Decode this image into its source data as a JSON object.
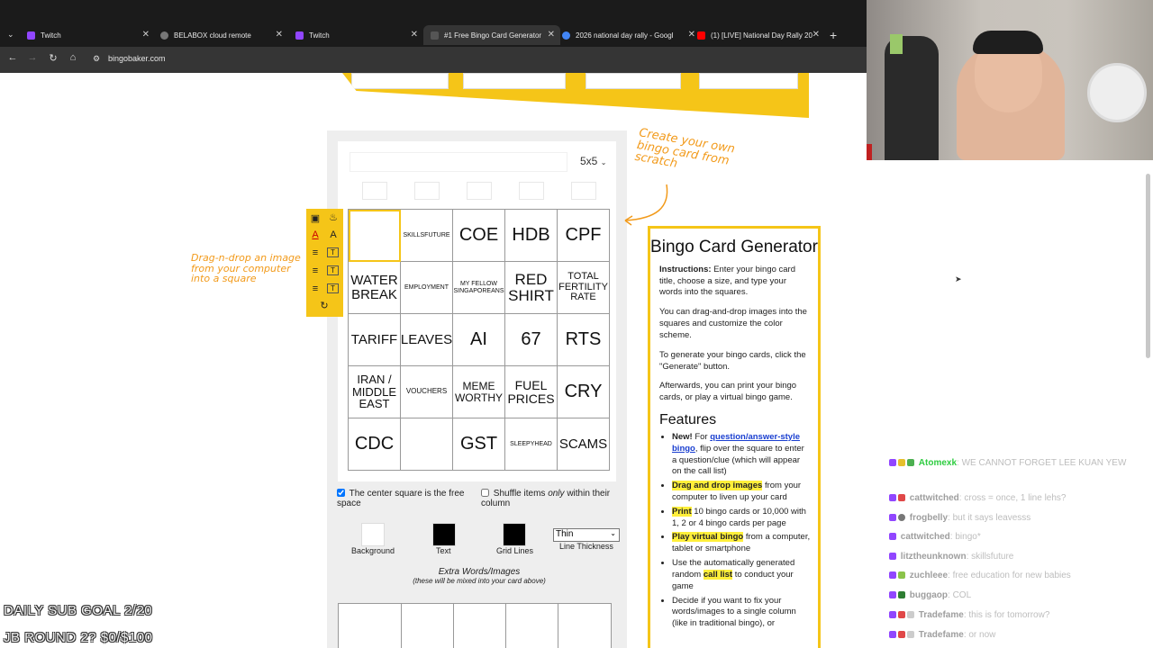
{
  "browser": {
    "tabs": [
      {
        "label": "Twitch",
        "fav_color": "#9146ff"
      },
      {
        "label": "BELABOX cloud remote",
        "fav_color": "#777777"
      },
      {
        "label": "Twitch",
        "fav_color": "#9146ff"
      },
      {
        "label": "#1 Free Bingo Card Generator",
        "fav_color": "#444444"
      },
      {
        "label": "2026 national day rally - Googl",
        "fav_color": "#4285f4"
      },
      {
        "label": "(1) [LIVE] National Day Rally 20",
        "fav_color": "#ff0000"
      }
    ],
    "url": "bingobaker.com"
  },
  "editor": {
    "size": "5x5",
    "grid": [
      [
        "",
        "SKILLSFUTURE",
        "COE",
        "HDB",
        "CPF"
      ],
      [
        "WATER BREAK",
        "EMPLOYMENT",
        "MY FELLOW SINGAPOREANS",
        "RED SHIRT",
        "TOTAL FERTILITY RATE"
      ],
      [
        "TARIFF",
        "LEAVES",
        "AI",
        "67",
        "RTS"
      ],
      [
        "IRAN / MIDDLE EAST",
        "VOUCHERS",
        "MEME WORTHY",
        "FUEL PRICES",
        "CRY"
      ],
      [
        "CDC",
        "",
        "GST",
        "SLEEPYHEAD",
        "SCAMS"
      ]
    ],
    "note_create": "Create your own bingo card from scratch",
    "note_drag": "Drag-n-drop an image from your computer into a square",
    "free_space_label": "The center square is the free space",
    "shuffle_label_a": "Shuffle items ",
    "shuffle_label_b": "only",
    "shuffle_label_c": " within their column",
    "bg_label": "Background",
    "text_label": "Text",
    "gridlines_label": "Grid Lines",
    "thickness_value": "Thin",
    "thickness_label": "Line Thickness",
    "extra_title": "Extra Words/Images",
    "extra_sub": "(these will be mixed into your card above)",
    "colors": {
      "background": "#ffffff",
      "text": "#000000",
      "grid_lines": "#000000",
      "accent": "#f5c518"
    }
  },
  "info": {
    "title": "Bingo Card Generator",
    "instr_bold": "Instructions:",
    "instr_text": " Enter your bingo card title, choose a size, and type your words into the squares.",
    "p2": "You can drag-and-drop images into the squares and customize the color scheme.",
    "p3": "To generate your bingo cards, click the \"Generate\" button.",
    "p4": "Afterwards, you can print your bingo cards, or play a virtual bingo game.",
    "features_title": "Features",
    "f1_new": "New!",
    "f1_for": " For ",
    "f1_link": "question/answer-style bingo",
    "f1_rest": ", flip over the square to enter a question/clue (which will appear on the call list)",
    "f2_hl": "Drag and drop images",
    "f2_rest": " from your computer to liven up your card",
    "f3_hl": "Print",
    "f3_rest": " 10 bingo cards or 10,000 with 1, 2 or 4 bingo cards per page",
    "f4_hl": "Play virtual bingo",
    "f4_rest": " from a computer, tablet or smartphone",
    "f5_a": "Use the automatically generated random ",
    "f5_hl": "call list",
    "f5_b": " to conduct your game",
    "f6": "Decide if you want to fix your words/images to a single column (like in traditional bingo), or"
  },
  "chat": [
    {
      "user": "Atomexk",
      "color": "#2ecc40",
      "text": "WE CANNOT FORGET LEE KUAN YEW"
    },
    {
      "user": "cattwitched",
      "color": "#9e9e9e",
      "text": "cross = once, 1 line lehs?"
    },
    {
      "user": "frogbelly",
      "color": "#9e9e9e",
      "text": "but it says leavesss"
    },
    {
      "user": "cattwitched",
      "color": "#9e9e9e",
      "text": "bingo*"
    },
    {
      "user": "litztheunknown",
      "color": "#9e9e9e",
      "text": "skillsfuture"
    },
    {
      "user": "zuchleee",
      "color": "#9e9e9e",
      "text": "free education for new babies"
    },
    {
      "user": "buggaop",
      "color": "#9e9e9e",
      "text": "COL"
    },
    {
      "user": "Tradefame",
      "color": "#9e9e9e",
      "text": "this is for tomorrow?"
    },
    {
      "user": "Tradefame",
      "color": "#9e9e9e",
      "text": "or now"
    }
  ],
  "overlay": {
    "line1": "DAILY SUB GOAL 2/20",
    "line2": "JB ROUND 2? $0/$100"
  }
}
